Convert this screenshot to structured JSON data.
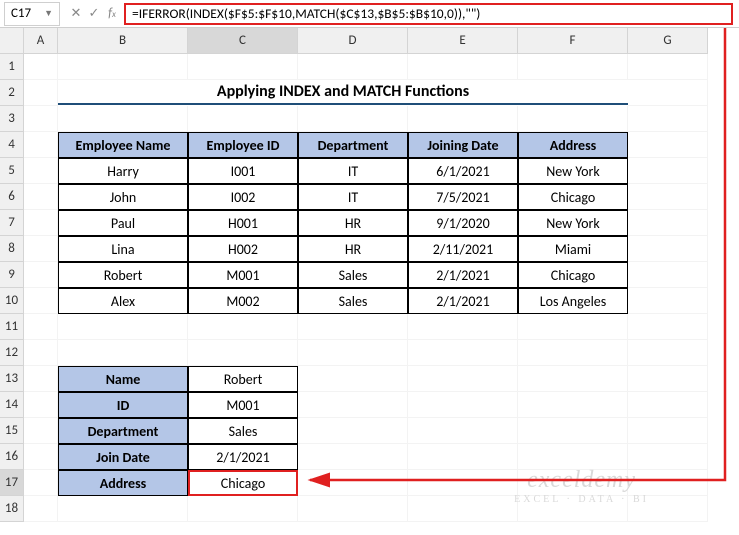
{
  "namebox": "C17",
  "formula": "=IFERROR(INDEX($F$5:$F$10,MATCH($C$13,$B$5:$B$10,0)),\"\")",
  "columns": [
    "A",
    "B",
    "C",
    "D",
    "E",
    "F",
    "G"
  ],
  "rows": [
    "1",
    "2",
    "3",
    "4",
    "5",
    "6",
    "7",
    "8",
    "9",
    "10",
    "11",
    "12",
    "13",
    "14",
    "15",
    "16",
    "17",
    "18"
  ],
  "title": "Applying INDEX and MATCH Functions",
  "table": {
    "headers": [
      "Employee Name",
      "Employee ID",
      "Department",
      "Joining Date",
      "Address"
    ],
    "rows": [
      [
        "Harry",
        "I001",
        "IT",
        "6/1/2021",
        "New York"
      ],
      [
        "John",
        "I002",
        "IT",
        "7/5/2021",
        "Chicago"
      ],
      [
        "Paul",
        "H001",
        "HR",
        "9/1/2020",
        "New York"
      ],
      [
        "Lina",
        "H002",
        "HR",
        "2/11/2021",
        "Miami"
      ],
      [
        "Robert",
        "M001",
        "Sales",
        "2/1/2021",
        "Chicago"
      ],
      [
        "Alex",
        "M002",
        "Sales",
        "2/1/2021",
        "Los Angeles"
      ]
    ]
  },
  "lookup": {
    "labels": [
      "Name",
      "ID",
      "Department",
      "Join Date",
      "Address"
    ],
    "values": [
      "Robert",
      "M001",
      "Sales",
      "2/1/2021",
      "Chicago"
    ]
  },
  "watermark": {
    "big": "exceldemy",
    "small": "EXCEL · DATA · BI"
  },
  "chart_data": {
    "type": "table",
    "title": "Applying INDEX and MATCH Functions",
    "columns": [
      "Employee Name",
      "Employee ID",
      "Department",
      "Joining Date",
      "Address"
    ],
    "rows": [
      [
        "Harry",
        "I001",
        "IT",
        "6/1/2021",
        "New York"
      ],
      [
        "John",
        "I002",
        "IT",
        "7/5/2021",
        "Chicago"
      ],
      [
        "Paul",
        "H001",
        "HR",
        "9/1/2020",
        "New York"
      ],
      [
        "Lina",
        "H002",
        "HR",
        "2/11/2021",
        "Miami"
      ],
      [
        "Robert",
        "M001",
        "Sales",
        "2/1/2021",
        "Chicago"
      ],
      [
        "Alex",
        "M002",
        "Sales",
        "2/1/2021",
        "Los Angeles"
      ]
    ]
  }
}
